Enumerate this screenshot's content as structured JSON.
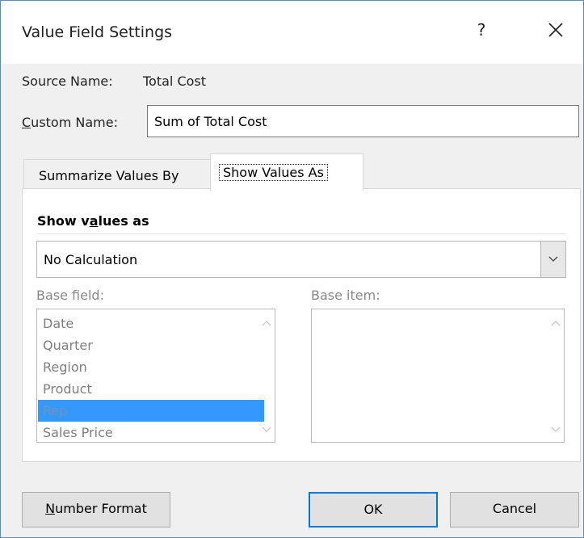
{
  "dialog": {
    "title": "Value Field Settings",
    "help_label": "?",
    "source_name_label": "Source Name:",
    "source_name_value": "Total Cost",
    "custom_name_label_u": "C",
    "custom_name_label_rest": "ustom Name:",
    "custom_name_value": "Sum of Total Cost"
  },
  "tabs": [
    {
      "label": "Summarize Values By",
      "active": false
    },
    {
      "label": "Show Values As",
      "active": true
    }
  ],
  "panel": {
    "section_title_pre": "Show v",
    "section_title_u": "a",
    "section_title_post": "lues as",
    "calculation_value": "No Calculation",
    "base_field_label": "Base field:",
    "base_item_label": "Base item:",
    "base_fields": [
      "Date",
      "Quarter",
      "Region",
      "Product",
      "Rep",
      "Sales Price"
    ],
    "selected_base_field": "Rep",
    "base_items": []
  },
  "buttons": {
    "number_format_u": "N",
    "number_format_rest": "umber Format",
    "ok": "OK",
    "cancel": "Cancel"
  },
  "colors": {
    "selection": "#3399ff",
    "default_button_border": "#0078d7"
  }
}
